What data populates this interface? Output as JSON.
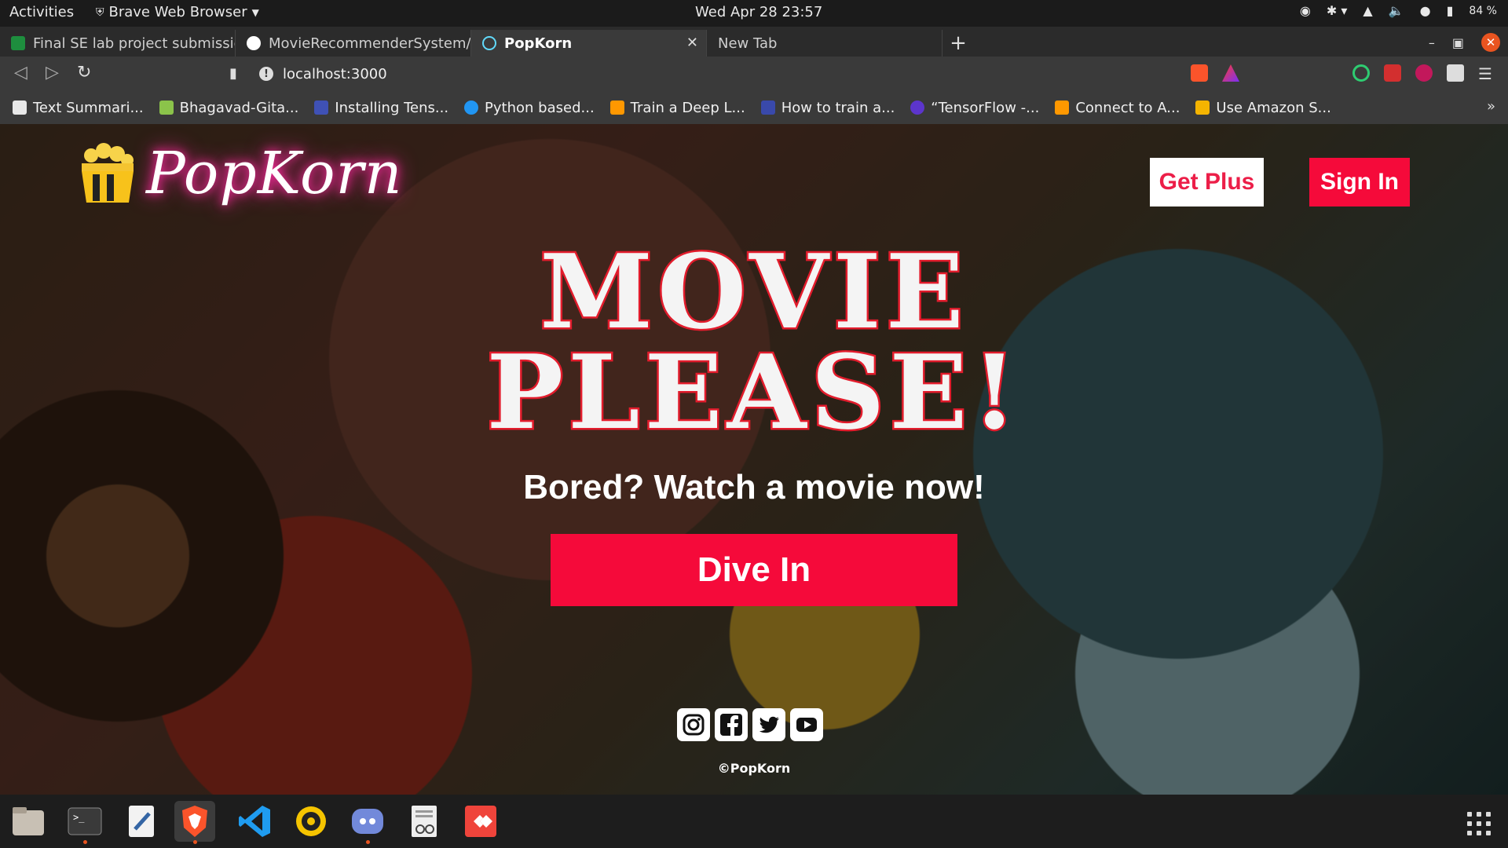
{
  "topbar": {
    "activities": "Activities",
    "app_name": "Brave Web Browser",
    "clock": "Wed Apr 28  23:57",
    "battery": "84 %"
  },
  "tabs": [
    {
      "label": "Final SE lab project submissio",
      "icon": "classroom-icon",
      "color": "#1e8e3e"
    },
    {
      "label": "MovieRecommenderSystem/",
      "icon": "github-icon",
      "color": "#ffffff"
    },
    {
      "label": "PopKorn",
      "icon": "react-icon",
      "color": "#61dafb",
      "active": true
    },
    {
      "label": "New Tab",
      "icon": "",
      "color": ""
    }
  ],
  "address_bar": {
    "url": "localhost:3000"
  },
  "bookmarks": [
    {
      "label": "Text Summari...",
      "color": "#e8e8e8"
    },
    {
      "label": "Bhagavad-Gita...",
      "color": "#8bc34a"
    },
    {
      "label": "Installing Tens...",
      "color": "#3f51b5"
    },
    {
      "label": "Python based...",
      "color": "#2196f3"
    },
    {
      "label": "Train a Deep L...",
      "color": "#ff9800"
    },
    {
      "label": "How to train a...",
      "color": "#3949ab"
    },
    {
      "label": "“TensorFlow -...",
      "color": "#5c35cc"
    },
    {
      "label": "Connect to A...",
      "color": "#ff9800"
    },
    {
      "label": "Use Amazon S...",
      "color": "#f4b400"
    }
  ],
  "page": {
    "brand": "PopKorn",
    "get_plus": "Get Plus",
    "sign_in": "Sign In",
    "hero_line1": "MOVIE",
    "hero_line2": "PLEASE!",
    "tagline": "Bored? Watch a movie now!",
    "cta": "Dive In",
    "copyright": "©PopKorn",
    "socials": [
      "instagram-icon",
      "facebook-icon",
      "twitter-icon",
      "youtube-icon"
    ],
    "accent_color": "#f50a3a"
  },
  "dock": [
    "files-icon",
    "terminal-icon",
    "text-editor-icon",
    "brave-icon",
    "vscode-icon",
    "rhythmbox-icon",
    "discord-icon",
    "document-viewer-icon",
    "anydesk-icon"
  ]
}
